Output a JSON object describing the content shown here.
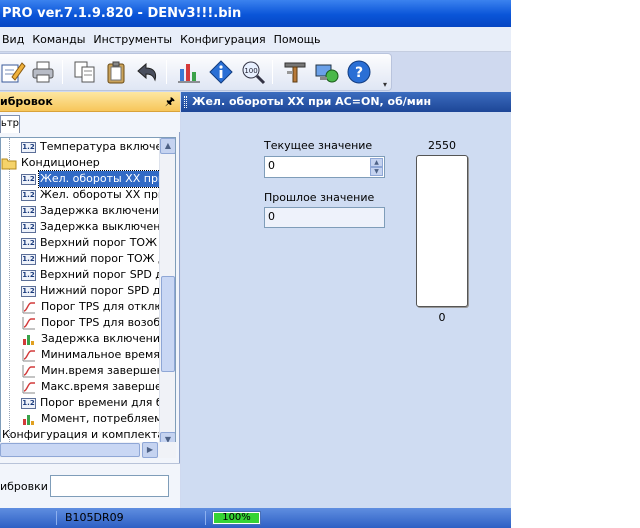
{
  "window": {
    "title": "PRO ver.7.1.9.820 - DENv3!!!.bin"
  },
  "menu": [
    "Вид",
    "Команды",
    "Инструменты",
    "Конфигурация",
    "Помощь"
  ],
  "toolbar": {
    "buttons": [
      "edit-icon",
      "printer-icon",
      "copy-icon",
      "clipboard-icon",
      "undo-icon",
      "chart-icon",
      "info-icon",
      "search-zoom-icon",
      "settings-icon",
      "network-icon",
      "help-icon"
    ],
    "overflow": "chevron-icon"
  },
  "left_panel": {
    "header": "ибровок",
    "pin": "🖈",
    "tab": "льтр",
    "tree": [
      {
        "label": "Температура включения п",
        "icon": "num-icon",
        "indent": 1
      },
      {
        "label": "Кондиционер",
        "icon": "folder-icon",
        "indent": 0
      },
      {
        "label": "Жел. обороты ХХ при ...",
        "icon": "num-icon",
        "indent": 1,
        "selected": true
      },
      {
        "label": "Жел. обороты ХХ при А",
        "icon": "num-icon",
        "indent": 1
      },
      {
        "label": "Задержка включения к",
        "icon": "num-icon",
        "indent": 1
      },
      {
        "label": "Задержка выключения",
        "icon": "num-icon",
        "indent": 1
      },
      {
        "label": "Верхний порог ТОЖ дл",
        "icon": "num-icon",
        "indent": 1
      },
      {
        "label": "Нижний порог ТОЖ дл",
        "icon": "num-icon",
        "indent": 1
      },
      {
        "label": "Верхний порог SPD дл",
        "icon": "num-icon",
        "indent": 1
      },
      {
        "label": "Нижний порог SPD для",
        "icon": "num-icon",
        "indent": 1
      },
      {
        "label": "Порог TPS для отключ",
        "icon": "curve-icon",
        "indent": 1
      },
      {
        "label": "Порог TPS для возобн",
        "icon": "curve-icon",
        "indent": 1
      },
      {
        "label": "Задержка включения г",
        "icon": "bar-chart-icon",
        "indent": 1
      },
      {
        "label": "Минимальное время в",
        "icon": "curve-icon",
        "indent": 1
      },
      {
        "label": "Мин.время завершени",
        "icon": "curve-icon",
        "indent": 1
      },
      {
        "label": "Макс.время завершен",
        "icon": "curve-icon",
        "indent": 1
      },
      {
        "label": "Порог времени для бе",
        "icon": "num-icon",
        "indent": 1
      },
      {
        "label": "Момент, потребляемы",
        "icon": "bar-chart-icon",
        "indent": 1
      },
      {
        "label": "Конфигурация и комплектаци",
        "icon": "none",
        "indent": 0
      }
    ],
    "bottom_label": "ибровки",
    "bottom_input": ""
  },
  "right_panel": {
    "header": "Жел. обороты ХХ при AC=ON, об/мин",
    "current_label": "Текущее значение",
    "current_value": "0",
    "previous_label": "Прошлое значение",
    "previous_value": "0",
    "gauge": {
      "max": "2550",
      "min": "0",
      "value": 0
    }
  },
  "status": {
    "file": "B105DR09",
    "progress": "100%",
    "progress_value": 100
  },
  "colors": {
    "title_bar": "#0a55d8",
    "panel_header": "#f7c65a",
    "right_header": "#1d4697",
    "selection": "#316ac5",
    "progress": "#35d335"
  }
}
